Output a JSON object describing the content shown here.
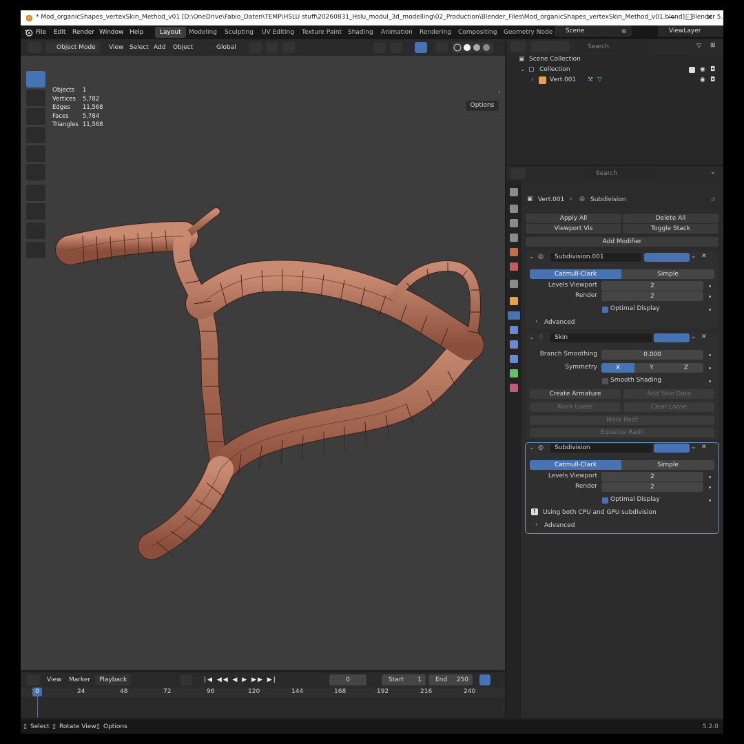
{
  "window": {
    "title": "* Mod_organicShapes_vertexSkin_Method_v01 [D:\\OneDrive\\Fabio_Daten\\TEMP\\HSLU stuff\\20260831_Hslu_modul_3d_modelling\\02_Production\\Blender_Files\\Mod_organicShapes_vertexSkin_Method_v01.blend] - Blender 5.2...",
    "minimize": "—",
    "maximize": "☐",
    "close": "✕"
  },
  "menu": [
    "File",
    "Edit",
    "Render",
    "Window",
    "Help"
  ],
  "workspaces": [
    "Layout",
    "Modeling",
    "Sculpting",
    "UV Editing",
    "Texture Paint",
    "Shading",
    "Animation",
    "Rendering",
    "Compositing",
    "Geometry Node"
  ],
  "scene": "Scene",
  "view_layer": "ViewLayer",
  "viewport_header": {
    "mode": "Object Mode",
    "view": "View",
    "select": "Select",
    "add": "Add",
    "object": "Object",
    "orientation": "Global",
    "options": "Options"
  },
  "stats": [
    {
      "label": "Objects",
      "value": "1"
    },
    {
      "label": "Vertices",
      "value": "5,782"
    },
    {
      "label": "Edges",
      "value": "11,568"
    },
    {
      "label": "Faces",
      "value": "5,784"
    },
    {
      "label": "Triangles",
      "value": "11,568"
    }
  ],
  "timeline": {
    "view": "View",
    "marker": "Marker",
    "playback": "Playback",
    "current_frame": "0",
    "start_label": "Start",
    "start": "1",
    "end_label": "End",
    "end": "250",
    "ticks": [
      "0",
      "24",
      "48",
      "72",
      "96",
      "120",
      "144",
      "168",
      "192",
      "216",
      "240"
    ]
  },
  "statusbar": {
    "select": "Select",
    "rotate": "Rotate View",
    "options": "Options",
    "version": "5.2.0"
  },
  "outliner": {
    "search_placeholder": "Search",
    "scene_collection": "Scene Collection",
    "collection": "Collection",
    "object": "Vert.001"
  },
  "properties": {
    "search_placeholder": "Search",
    "breadcrumb_object": "Vert.001",
    "breadcrumb_modifier": "Subdivision",
    "apply_all": "Apply All",
    "delete_all": "Delete All",
    "viewport_vis": "Viewport Vis",
    "toggle_stack": "Toggle Stack",
    "add_modifier": "Add Modifier",
    "modifiers": [
      {
        "name": "Subdivision.001",
        "type_a": "Catmull-Clark",
        "type_b": "Simple",
        "levels_label": "Levels Viewport",
        "levels": "2",
        "render_label": "Render",
        "render": "2",
        "optimal": "Optimal Display",
        "advanced": "Advanced"
      },
      {
        "name": "Skin",
        "branch_label": "Branch Smoothing",
        "branch": "0.000",
        "symmetry_label": "Symmetry",
        "sym": [
          "X",
          "Y",
          "Z"
        ],
        "smooth": "Smooth Shading",
        "create_armature": "Create Armature",
        "add_skin_data": "Add Skin Data",
        "mark_loose": "Mark Loose",
        "clear_loose": "Clear Loose",
        "mark_root": "Mark Root",
        "equalize": "Equalize Radii"
      },
      {
        "name": "Subdivision",
        "type_a": "Catmull-Clark",
        "type_b": "Simple",
        "levels_label": "Levels Viewport",
        "levels": "2",
        "render_label": "Render",
        "render": "2",
        "optimal": "Optimal Display",
        "info": "Using both CPU and GPU subdivision",
        "advanced": "Advanced"
      }
    ]
  },
  "colors": {
    "accent": "#4772b3",
    "mesh": "#9a5c48",
    "mesh_light": "#c98a72",
    "wire": "#3a2018"
  }
}
